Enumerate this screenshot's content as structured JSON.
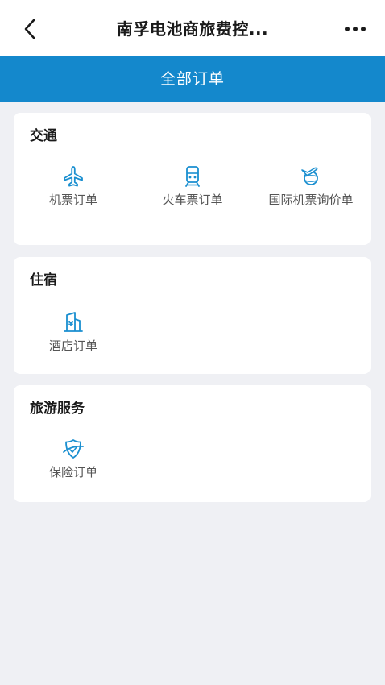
{
  "nav": {
    "title": "南孚电池商旅费控..."
  },
  "header": {
    "label": "全部订单"
  },
  "colors": {
    "accent": "#1488cc",
    "page_background": "#eff0f4",
    "icon": "#1a8fd0"
  },
  "sections": {
    "transport": {
      "title": "交通",
      "items": [
        {
          "label": "机票订单",
          "icon": "airplane-icon"
        },
        {
          "label": "火车票订单",
          "icon": "train-icon"
        },
        {
          "label": "国际机票询价单",
          "icon": "international-flight-icon"
        }
      ]
    },
    "lodging": {
      "title": "住宿",
      "items": [
        {
          "label": "酒店订单",
          "icon": "hotel-icon"
        }
      ]
    },
    "travel": {
      "title": "旅游服务",
      "items": [
        {
          "label": "保险订单",
          "icon": "insurance-shield-icon"
        }
      ]
    }
  }
}
